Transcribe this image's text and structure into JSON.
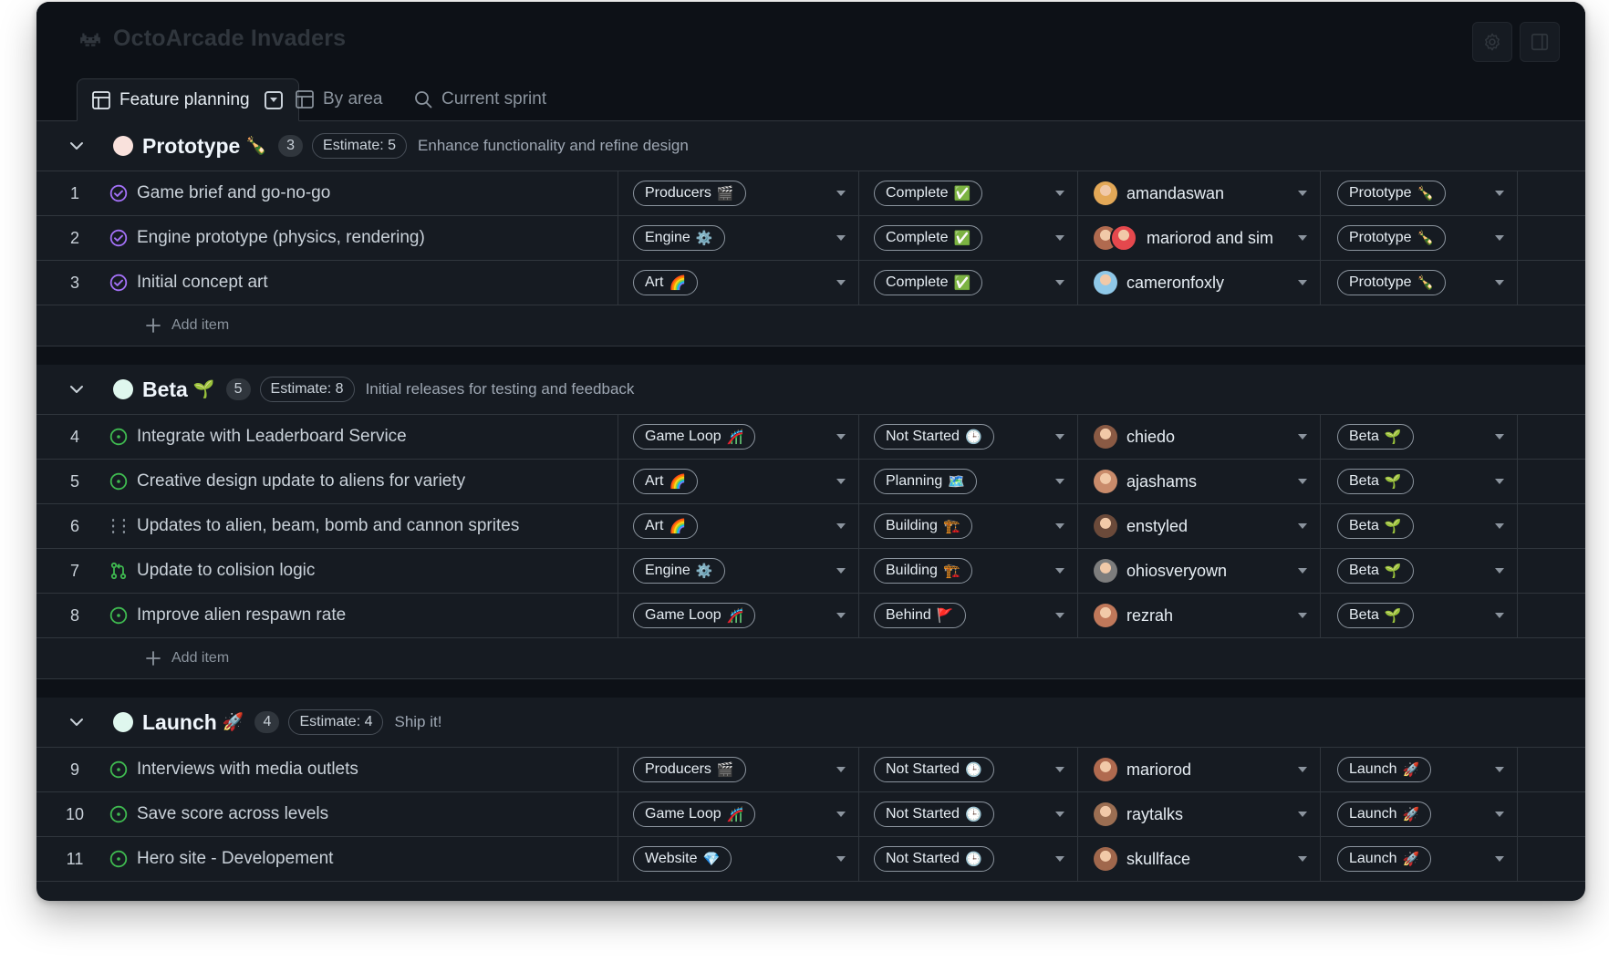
{
  "app": {
    "title": "OctoArcade Invaders"
  },
  "tabs": [
    {
      "label": "Feature planning",
      "active": true,
      "icon": "table-icon"
    },
    {
      "label": "By area",
      "active": false,
      "icon": "table-icon"
    },
    {
      "label": "Current sprint",
      "active": false,
      "icon": "search-icon"
    }
  ],
  "add_item_label": "Add item",
  "colors": {
    "done": "#a371f7",
    "open": "#3fb950",
    "draft": "#8b949e",
    "background": "#161b22",
    "border": "#30363d"
  },
  "groups": [
    {
      "name": "Prototype",
      "emoji": "🍾",
      "count": "3",
      "estimate": "Estimate: 5",
      "description": "Enhance functionality and refine design",
      "dot_color": "#f9e1dc",
      "rows": [
        {
          "num": "1",
          "state": "done",
          "title": "Game brief and go-no-go",
          "area": "Producers",
          "area_emoji": "🎬",
          "status": "Complete",
          "status_emoji": "✅",
          "assignee": "amandaswan",
          "avatars": [
            "#e3a857"
          ],
          "phase": "Prototype",
          "phase_emoji": "🍾"
        },
        {
          "num": "2",
          "state": "done",
          "title": "Engine prototype (physics, rendering)",
          "area": "Engine",
          "area_emoji": "⚙️",
          "status": "Complete",
          "status_emoji": "✅",
          "assignee": "mariorod and sim",
          "avatars": [
            "#b06a4f",
            "#e5484d"
          ],
          "phase": "Prototype",
          "phase_emoji": "🍾"
        },
        {
          "num": "3",
          "state": "done",
          "title": "Initial concept art",
          "area": "Art",
          "area_emoji": "🌈",
          "status": "Complete",
          "status_emoji": "✅",
          "assignee": "cameronfoxly",
          "avatars": [
            "#8fc8e8"
          ],
          "phase": "Prototype",
          "phase_emoji": "🍾"
        }
      ]
    },
    {
      "name": "Beta",
      "emoji": "🌱",
      "count": "5",
      "estimate": "Estimate: 8",
      "description": "Initial releases for testing and feedback",
      "dot_color": "#dff7ee",
      "rows": [
        {
          "num": "4",
          "state": "open",
          "title": "Integrate with Leaderboard Service",
          "area": "Game Loop",
          "area_emoji": "🎢",
          "status": "Not Started",
          "status_emoji": "🕒",
          "assignee": "chiedo",
          "avatars": [
            "#8a5a44"
          ],
          "phase": "Beta",
          "phase_emoji": "🌱"
        },
        {
          "num": "5",
          "state": "open",
          "title": "Creative design update to aliens for variety",
          "area": "Art",
          "area_emoji": "🌈",
          "status": "Planning",
          "status_emoji": "🗺️",
          "assignee": "ajashams",
          "avatars": [
            "#c98b6b"
          ],
          "phase": "Beta",
          "phase_emoji": "🌱"
        },
        {
          "num": "6",
          "state": "draft",
          "title": "Updates to alien, beam, bomb and cannon sprites",
          "area": "Art",
          "area_emoji": "🌈",
          "status": "Building",
          "status_emoji": "🏗️",
          "assignee": "enstyled",
          "avatars": [
            "#6b4a3a"
          ],
          "phase": "Beta",
          "phase_emoji": "🌱"
        },
        {
          "num": "7",
          "state": "pr",
          "title": "Update to colision logic",
          "area": "Engine",
          "area_emoji": "⚙️",
          "status": "Building",
          "status_emoji": "🏗️",
          "assignee": "ohiosveryown",
          "avatars": [
            "#7d7d7d"
          ],
          "phase": "Beta",
          "phase_emoji": "🌱"
        },
        {
          "num": "8",
          "state": "open",
          "title": "Improve alien respawn rate",
          "area": "Game Loop",
          "area_emoji": "🎢",
          "status": "Behind",
          "status_emoji": "🚩",
          "assignee": "rezrah",
          "avatars": [
            "#c0785a"
          ],
          "phase": "Beta",
          "phase_emoji": "🌱"
        }
      ]
    },
    {
      "name": "Launch",
      "emoji": "🚀",
      "count": "4",
      "estimate": "Estimate: 4",
      "description": "Ship it!",
      "dot_color": "#dff7ee",
      "rows": [
        {
          "num": "9",
          "state": "open",
          "title": "Interviews with media outlets",
          "area": "Producers",
          "area_emoji": "🎬",
          "status": "Not Started",
          "status_emoji": "🕒",
          "assignee": "mariorod",
          "avatars": [
            "#b06a4f"
          ],
          "phase": "Launch",
          "phase_emoji": "🚀"
        },
        {
          "num": "10",
          "state": "open",
          "title": "Save score across levels",
          "area": "Game Loop",
          "area_emoji": "🎢",
          "status": "Not Started",
          "status_emoji": "🕒",
          "assignee": "raytalks",
          "avatars": [
            "#9b6e52"
          ],
          "phase": "Launch",
          "phase_emoji": "🚀"
        },
        {
          "num": "11",
          "state": "open",
          "title": "Hero site - Developement",
          "area": "Website",
          "area_emoji": "💎",
          "status": "Not Started",
          "status_emoji": "🕒",
          "assignee": "skullface",
          "avatars": [
            "#a0674c"
          ],
          "phase": "Launch",
          "phase_emoji": "🚀"
        }
      ]
    }
  ]
}
